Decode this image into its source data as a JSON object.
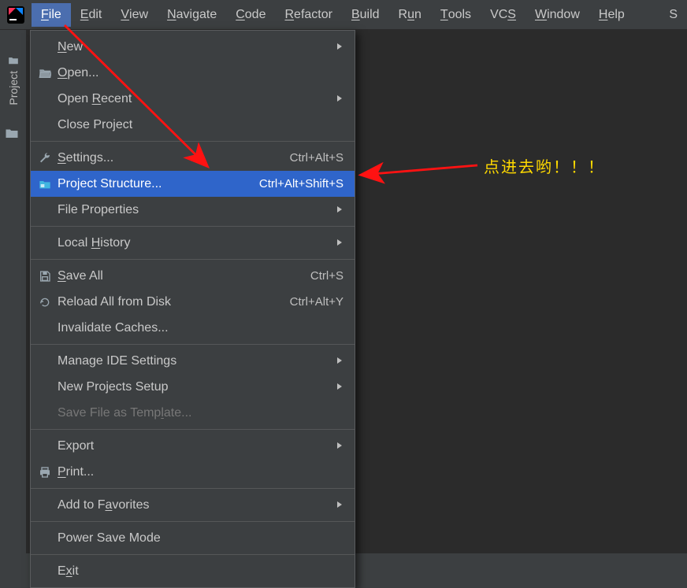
{
  "menubar": {
    "items": [
      {
        "label": "File",
        "mn": "F"
      },
      {
        "label": "Edit",
        "mn": "E"
      },
      {
        "label": "View",
        "mn": "V"
      },
      {
        "label": "Navigate",
        "mn": "N"
      },
      {
        "label": "Code",
        "mn": "C"
      },
      {
        "label": "Refactor",
        "mn": "R"
      },
      {
        "label": "Build",
        "mn": "B"
      },
      {
        "label": "Run",
        "mn": "u",
        "pre": "R"
      },
      {
        "label": "Tools",
        "mn": "T"
      },
      {
        "label": "VCS",
        "mn": "S",
        "pre": "VC"
      },
      {
        "label": "Window",
        "mn": "W"
      },
      {
        "label": "Help",
        "mn": "H"
      }
    ],
    "trailing": "S"
  },
  "sidebar": {
    "project_tab": "Project"
  },
  "fragment": {
    "su": "Su"
  },
  "dropdown": {
    "groups": [
      [
        {
          "icon": "",
          "label": "New",
          "mn": "N",
          "sub": true
        },
        {
          "icon": "open",
          "label": "Open...",
          "mn": "O"
        },
        {
          "icon": "",
          "label": "Open Recent",
          "mn": "R",
          "pre": "Open ",
          "sub": true
        },
        {
          "icon": "",
          "label": "Close Project",
          "mn": "j",
          "pre": "Close Pro"
        }
      ],
      [
        {
          "icon": "wrench",
          "label": "Settings...",
          "mn": "S",
          "shortcut": "Ctrl+Alt+S"
        },
        {
          "icon": "proj",
          "label": "Project Structure...",
          "mn": "",
          "shortcut": "Ctrl+Alt+Shift+S",
          "hl": true
        },
        {
          "icon": "",
          "label": "File Properties",
          "sub": true
        }
      ],
      [
        {
          "icon": "",
          "label": "Local History",
          "mn": "H",
          "pre": "Local ",
          "sub": true
        }
      ],
      [
        {
          "icon": "save",
          "label": "Save All",
          "mn": "S",
          "shortcut": "Ctrl+S"
        },
        {
          "icon": "reload",
          "label": "Reload All from Disk",
          "shortcut": "Ctrl+Alt+Y"
        },
        {
          "icon": "",
          "label": "Invalidate Caches..."
        }
      ],
      [
        {
          "icon": "",
          "label": "Manage IDE Settings",
          "sub": true
        },
        {
          "icon": "",
          "label": "New Projects Setup",
          "sub": true
        },
        {
          "icon": "",
          "label": "Save File as Template...",
          "mn": "l",
          "pre": "Save File as Temp",
          "disabled": true
        }
      ],
      [
        {
          "icon": "",
          "label": "Export",
          "sub": true
        },
        {
          "icon": "print",
          "label": "Print...",
          "mn": "P"
        }
      ],
      [
        {
          "icon": "",
          "label": "Add to Favorites",
          "mn": "a",
          "pre": "Add to F",
          "sub": true
        }
      ],
      [
        {
          "icon": "",
          "label": "Power Save Mode"
        }
      ],
      [
        {
          "icon": "",
          "label": "Exit",
          "mn": "x",
          "pre": "E"
        }
      ]
    ]
  },
  "annotation": {
    "text": "点进去哟！！！"
  }
}
